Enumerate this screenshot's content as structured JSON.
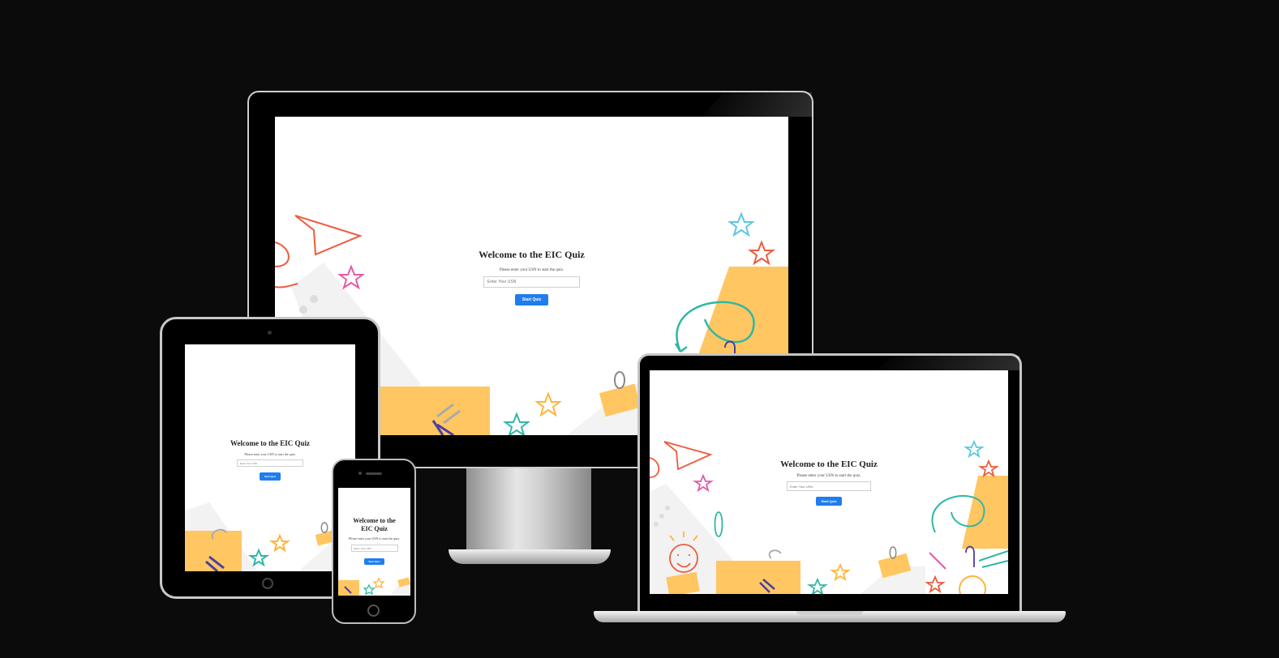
{
  "quiz": {
    "title": "Welcome to the EIC Quiz",
    "title_line1": "Welcome to the",
    "title_line2": "EIC Quiz",
    "instruction": "Please enter your USN to start the quiz.",
    "usn_placeholder": "Enter Your USN",
    "start_button": "Start Quiz"
  },
  "colors": {
    "background": "#0b0b0b",
    "button": "#1f7df0",
    "accent_orange": "#ffc661",
    "accent_red": "#ee5a3c",
    "accent_teal": "#2fb7a6",
    "accent_pink": "#e45aa8"
  },
  "devices": [
    "desktop-monitor",
    "laptop",
    "tablet",
    "phone"
  ]
}
